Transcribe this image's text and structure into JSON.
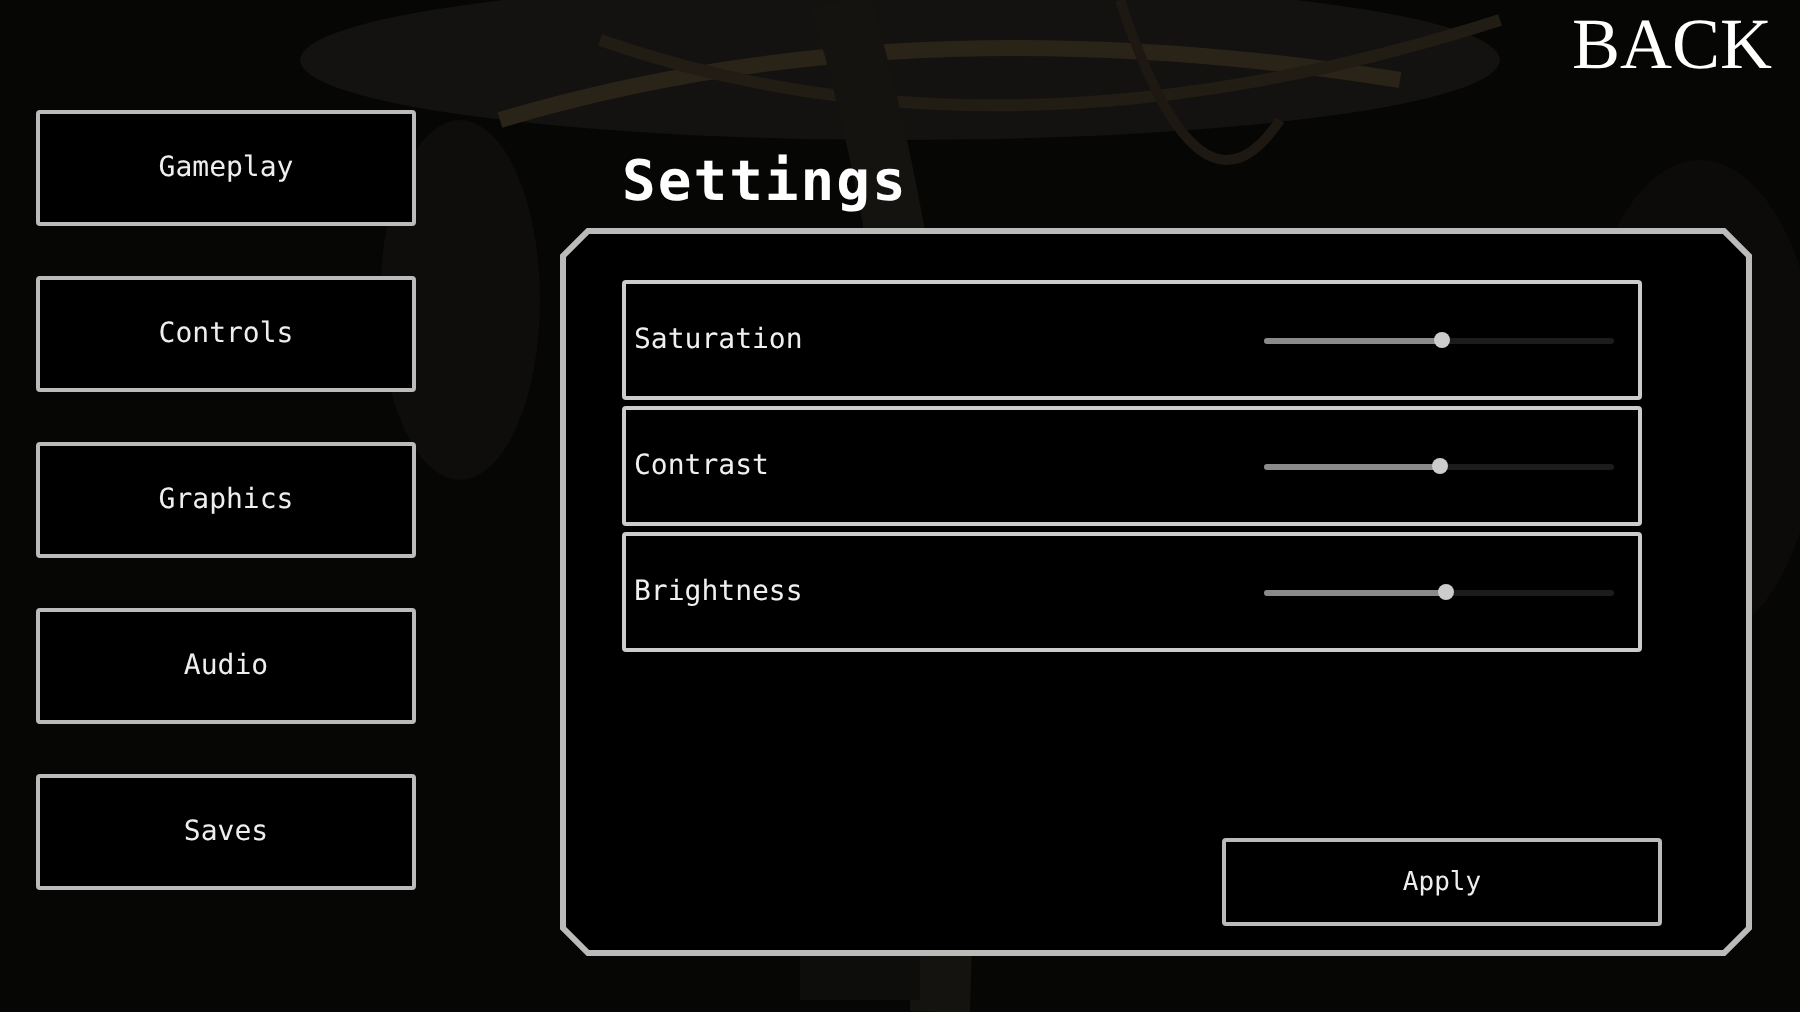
{
  "back_button": "BACK",
  "sidebar": {
    "items": [
      "Gameplay",
      "Controls",
      "Graphics",
      "Audio",
      "Saves"
    ]
  },
  "settings": {
    "title": "Settings",
    "sliders": [
      {
        "label": "Saturation",
        "level": 0.51
      },
      {
        "label": "Contrast",
        "level": 0.5
      },
      {
        "label": "Brightness",
        "level": 0.52
      }
    ],
    "apply_button": "Apply"
  }
}
